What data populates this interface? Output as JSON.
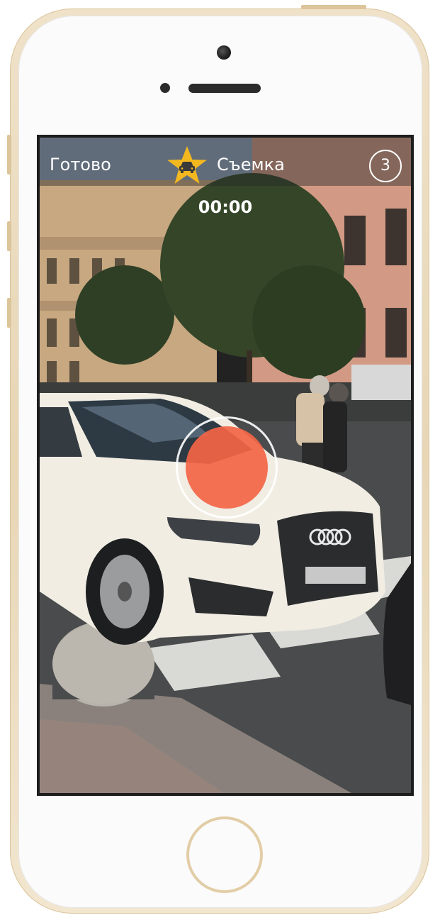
{
  "topbar": {
    "done_label": "Готово",
    "mode_label": "Съемка",
    "count": "3",
    "star_color": "#f3b81f"
  },
  "timer": "00:00",
  "record": {
    "accent_color": "#f46547"
  },
  "icons": {
    "mode_icon": "star-car-icon",
    "record_icon": "record-button-icon"
  }
}
